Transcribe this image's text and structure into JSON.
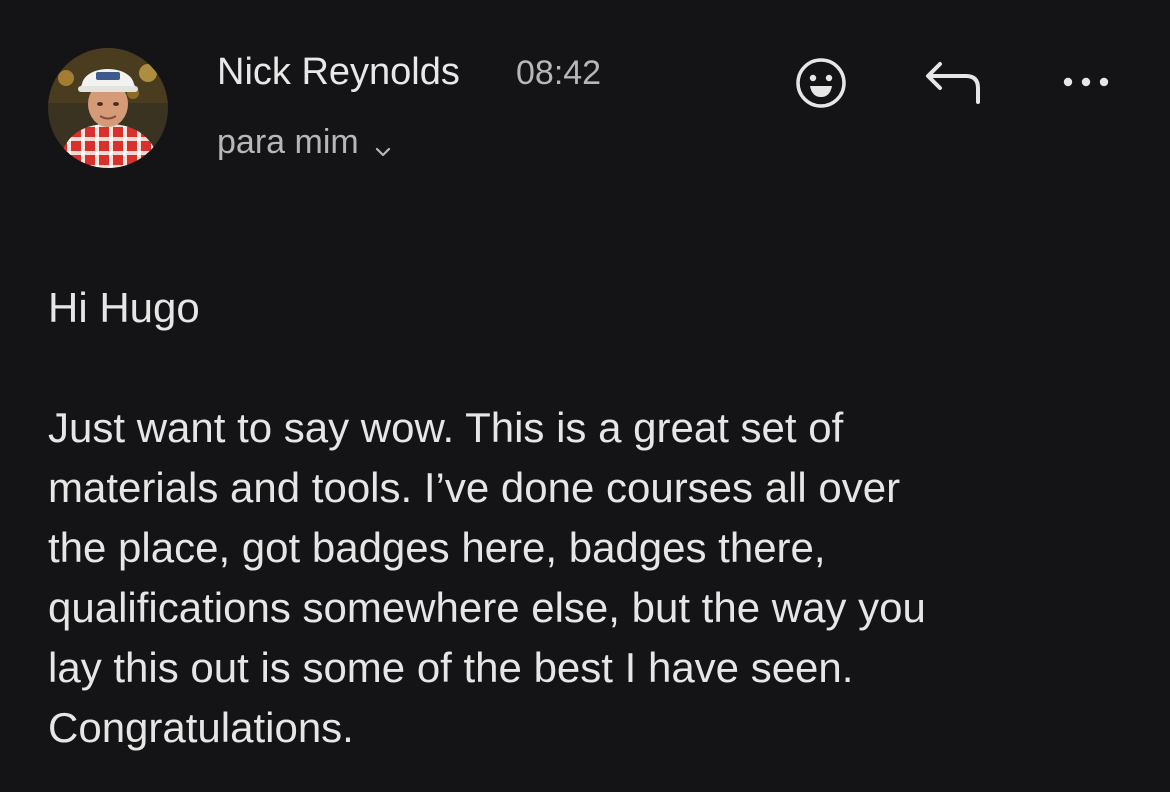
{
  "email": {
    "sender_name": "Nick Reynolds",
    "time": "08:42",
    "recipient": "para mim",
    "greeting": "Hi Hugo",
    "body_lines": [
      "Just want to say wow. This is a great set of",
      "materials and tools. I’ve done courses all over",
      "the place, got badges here, badges there,",
      "qualifications somewhere else, but the way you",
      "lay this out is some of the best I have seen.",
      "Congratulations."
    ]
  },
  "icons": {
    "avatar": "sender-avatar-photo",
    "recipient_toggle": "chevron-down-icon",
    "emoji": "smiley-icon",
    "reply": "reply-arrow-icon",
    "more": "more-options-icon"
  },
  "colors": {
    "background": "#141416",
    "text_primary": "#e6e6e6",
    "text_secondary": "#b7b7b9"
  }
}
